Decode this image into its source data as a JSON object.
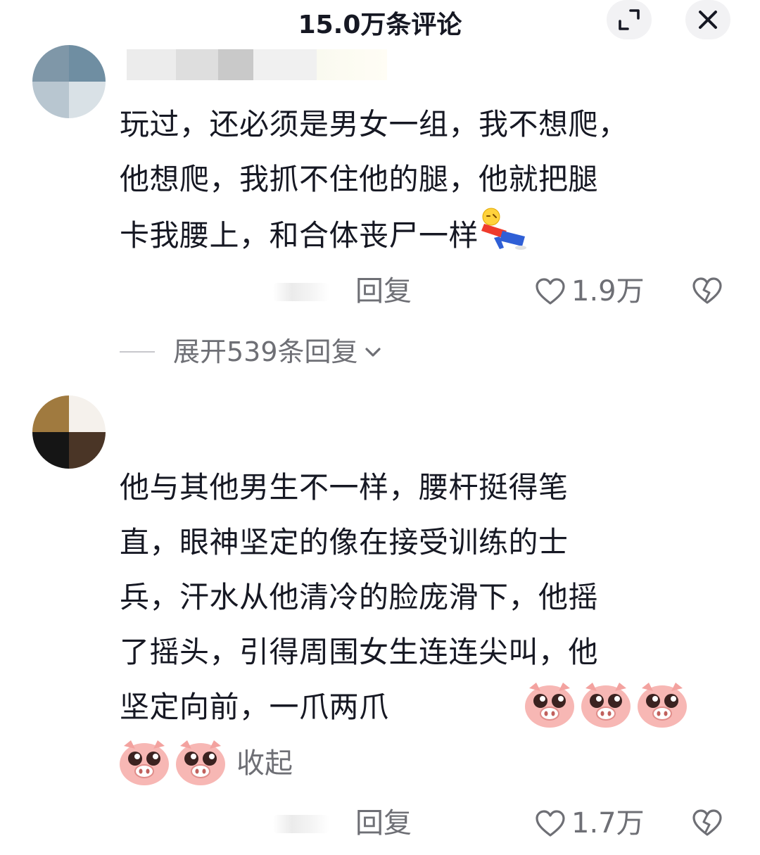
{
  "header": {
    "title": "15.0万条评论"
  },
  "comments": [
    {
      "text_lines": [
        "玩过，还必须是男女一组，我不想爬，",
        "他想爬，我抓不住他的腿，他就把腿",
        "卡我腰上，和合体丧尸一样"
      ],
      "inline_emoji": "lying-down-emoji",
      "reply_label": "回复",
      "like_count": "1.9万",
      "expand_replies_label": "展开539条回复"
    },
    {
      "text_lines": [
        "他与其他男生不一样，腰杆挺得笔",
        "直，眼神坚定的像在接受训练的士",
        "兵，汗水从他清冷的脸庞滑下，他摇",
        "了摇头，引得周围女生连连尖叫，他",
        "坚定向前，一爪两爪"
      ],
      "inline_emoji": "pig-face-emoji",
      "collapse_label": "收起",
      "reply_label": "回复",
      "like_count": "1.7万"
    }
  ],
  "colors": {
    "text_primary": "#161823",
    "text_secondary": "#6e6f75",
    "button_bg": "#f2f2f4",
    "pig_pink": "#f7b7b4"
  }
}
